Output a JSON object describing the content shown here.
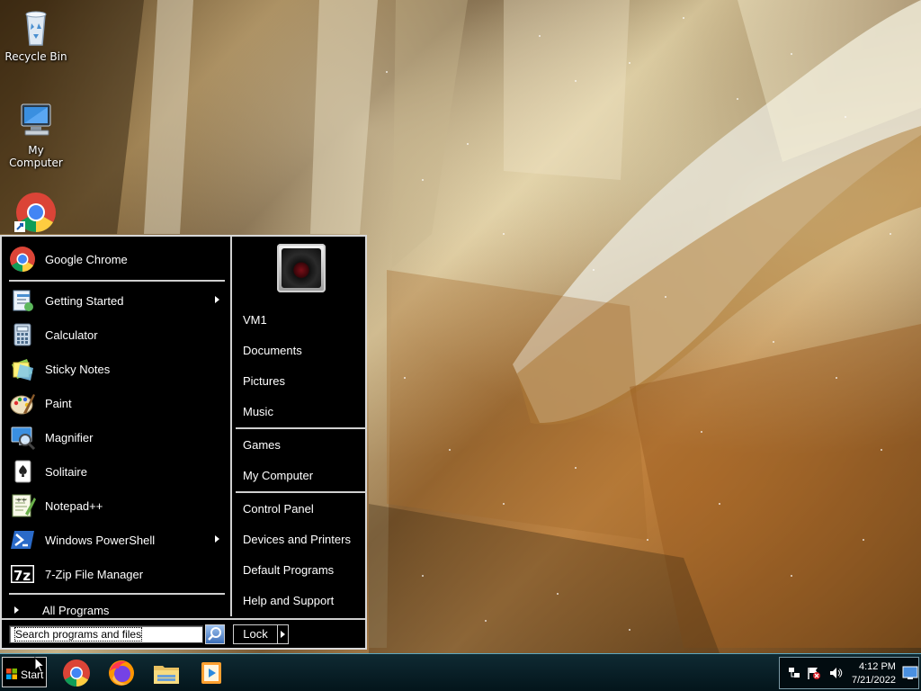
{
  "desktop": {
    "icons": [
      {
        "label": "Recycle Bin",
        "icon": "recycle-bin-icon"
      },
      {
        "label": "My Computer",
        "icon": "computer-icon"
      },
      {
        "label": "",
        "icon": "chrome-shortcut-icon"
      }
    ]
  },
  "start_menu": {
    "pinned": [
      {
        "label": "Google Chrome",
        "icon": "chrome-icon"
      }
    ],
    "programs": [
      {
        "label": "Getting Started",
        "icon": "getting-started-icon",
        "submenu": true
      },
      {
        "label": "Calculator",
        "icon": "calculator-icon",
        "submenu": false
      },
      {
        "label": "Sticky Notes",
        "icon": "sticky-notes-icon",
        "submenu": false
      },
      {
        "label": "Paint",
        "icon": "paint-icon",
        "submenu": false
      },
      {
        "label": "Magnifier",
        "icon": "magnifier-icon",
        "submenu": false
      },
      {
        "label": "Solitaire",
        "icon": "solitaire-icon",
        "submenu": false
      },
      {
        "label": "Notepad++",
        "icon": "notepadpp-icon",
        "submenu": false
      },
      {
        "label": "Windows PowerShell",
        "icon": "powershell-icon",
        "submenu": true
      },
      {
        "label": "7-Zip File Manager",
        "icon": "7zip-icon",
        "submenu": false
      }
    ],
    "all_programs": "All Programs",
    "places_group1": [
      "VM1",
      "Documents",
      "Pictures",
      "Music"
    ],
    "places_group2": [
      "Games",
      "My Computer"
    ],
    "places_group3": [
      "Control Panel",
      "Devices and Printers",
      "Default Programs",
      "Help and Support"
    ],
    "search": {
      "placeholder": "Search programs and files"
    },
    "lock_label": "Lock"
  },
  "taskbar": {
    "start_label": "Start",
    "apps": [
      "chrome-icon",
      "firefox-icon",
      "file-explorer-icon",
      "media-player-icon"
    ],
    "tray": {
      "icons": [
        "network-icon",
        "action-center-flag-icon",
        "volume-icon",
        "show-desktop-icon"
      ],
      "time": "4:12 PM",
      "date": "7/21/2022"
    }
  },
  "colors": {
    "menu_bg": "#000000",
    "menu_border": "#d8d8d8",
    "taskbar_bg": "#0a1f26",
    "accent_blue": "#3d6fb8"
  }
}
